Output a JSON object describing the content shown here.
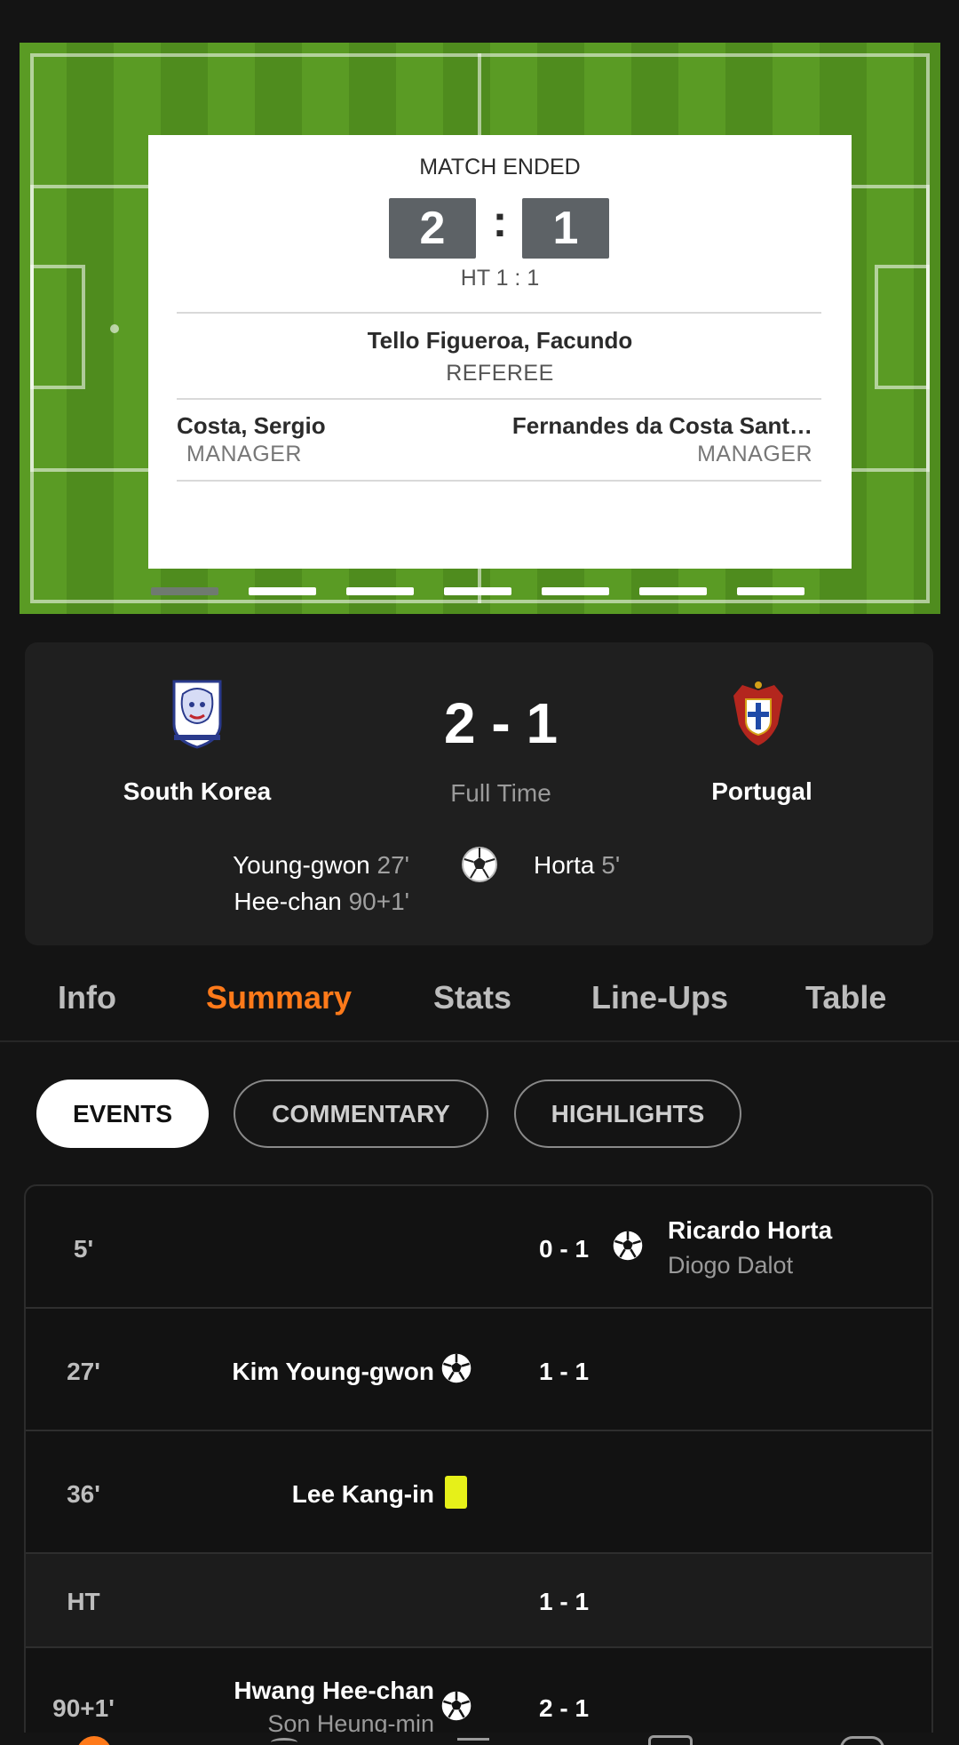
{
  "card": {
    "status": "MATCH ENDED",
    "home_score": "2",
    "away_score": "1",
    "colon": ":",
    "halftime": "HT  1 : 1",
    "referee_name": "Tello Figueroa, Facundo",
    "referee_role": "REFEREE",
    "home_manager_name": "Costa, Sergio",
    "home_manager_role": "MANAGER",
    "away_manager_name": "Fernandes da Costa Sant…",
    "away_manager_role": "MANAGER",
    "carousel_pages": 7,
    "carousel_active_index": 0
  },
  "match": {
    "home_team": "South Korea",
    "away_team": "Portugal",
    "score": "2 - 1",
    "status": "Full Time",
    "home_scorers": [
      {
        "name": "Young-gwon",
        "minute": "27'"
      },
      {
        "name": "Hee-chan",
        "minute": "90+1'"
      }
    ],
    "away_scorers": [
      {
        "name": "Horta",
        "minute": "5'"
      }
    ]
  },
  "tabs": [
    "Info",
    "Summary",
    "Stats",
    "Line-Ups",
    "Table"
  ],
  "active_tab": "Summary",
  "pills": [
    "EVENTS",
    "COMMENTARY",
    "HIGHLIGHTS"
  ],
  "active_pill": "EVENTS",
  "events": [
    {
      "minute": "5'",
      "score": "0 - 1",
      "side": "away",
      "type": "goal",
      "player": "Ricardo Horta",
      "assist": "Diogo Dalot"
    },
    {
      "minute": "27'",
      "score": "1 - 1",
      "side": "home",
      "type": "goal",
      "player": "Kim Young-gwon",
      "assist": ""
    },
    {
      "minute": "36'",
      "score": "",
      "side": "home",
      "type": "yellow-card",
      "player": "Lee Kang-in",
      "assist": ""
    },
    {
      "minute": "HT",
      "score": "1 - 1",
      "side": "",
      "type": "halftime",
      "player": "",
      "assist": ""
    },
    {
      "minute": "90+1'",
      "score": "2 - 1",
      "side": "home",
      "type": "goal",
      "player": "Hwang Hee-chan",
      "assist": "Son Heung-min"
    }
  ],
  "colors": {
    "accent": "#ff7a1a",
    "background": "#141414",
    "panel": "#1f1f1f",
    "pitch_light": "#5a9b24",
    "pitch_dark": "#4f8c1e",
    "yellow_card": "#e6f019"
  }
}
